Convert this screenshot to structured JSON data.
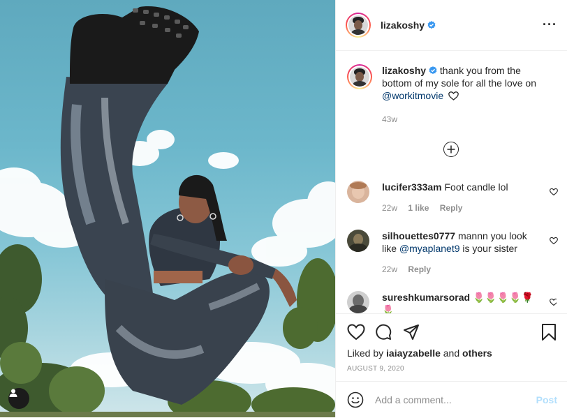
{
  "post": {
    "author": "lizakoshy",
    "verified": true,
    "more_icon": "more-options-icon"
  },
  "caption": {
    "author": "lizakoshy",
    "text_before": "thank you from the bottom of my sole for all the love on ",
    "mention": "@workitmovie",
    "time": "43w"
  },
  "comments": [
    {
      "author": "lucifer333am",
      "text": "Foot candle lol",
      "time": "22w",
      "likes": "1 like",
      "reply": "Reply"
    },
    {
      "author": "silhouettes0777",
      "text_before": "mannn you look like ",
      "mention": "@myaplanet9",
      "text_after": " is your sister",
      "time": "22w",
      "reply": "Reply"
    },
    {
      "author": "sureshkumarsorad",
      "emoji": "🌷🌷🌷🌷🌹🌷"
    }
  ],
  "actions": {
    "liked_by_prefix": "Liked by ",
    "liked_by_user": "iaiayzabelle",
    "liked_by_middle": " and ",
    "liked_by_others": "others",
    "date": "AUGUST 9, 2020"
  },
  "add_comment": {
    "placeholder": "Add a comment...",
    "post_label": "Post"
  },
  "colors": {
    "accent": "#0095f6",
    "post_disabled": "#b2dffc",
    "mention": "#00376b",
    "muted": "#8e8e8e"
  }
}
